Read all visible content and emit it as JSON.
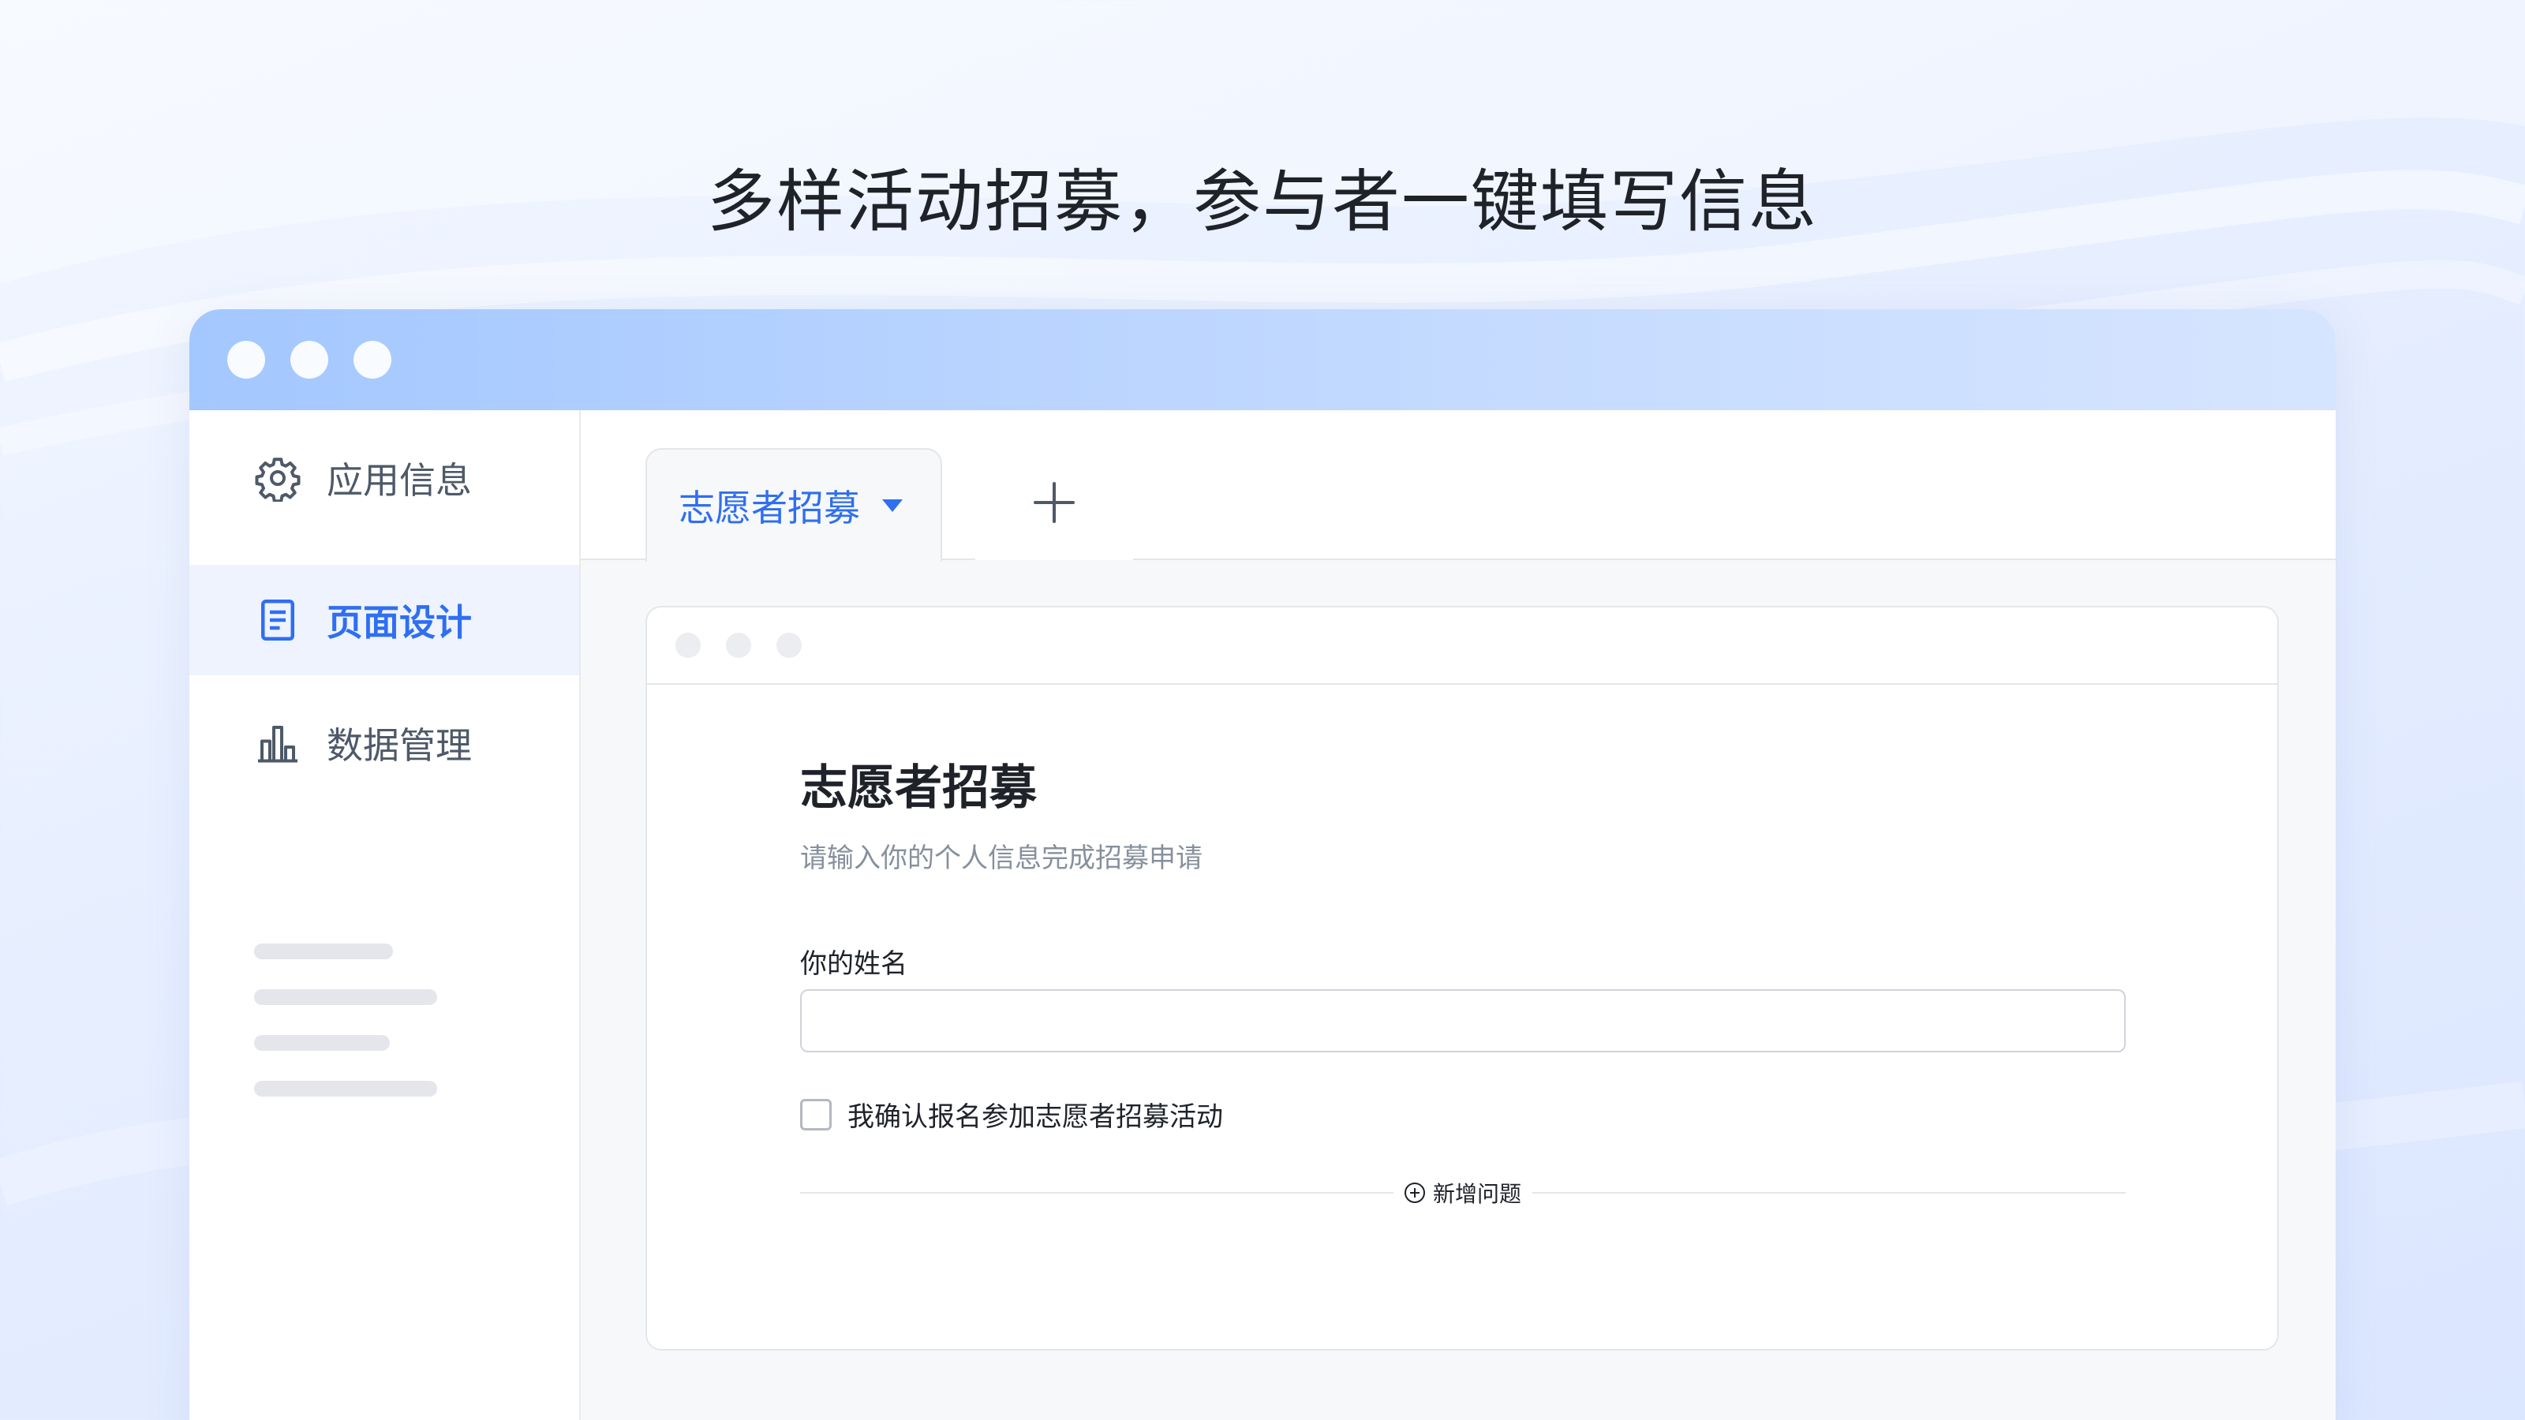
{
  "headline": "多样活动招募，参与者一键填写信息",
  "sidebar": {
    "items": [
      {
        "label": "应用信息",
        "icon": "gear-icon",
        "active": false
      },
      {
        "label": "页面设计",
        "icon": "document-icon",
        "active": true
      },
      {
        "label": "数据管理",
        "icon": "bar-chart-icon",
        "active": false
      }
    ]
  },
  "tabs": {
    "active_label": "志愿者招募",
    "add_icon": "plus-icon"
  },
  "form": {
    "title": "志愿者招募",
    "description": "请输入你的个人信息完成招募申请",
    "name_label": "你的姓名",
    "name_value": "",
    "confirm_label": "我确认报名参加志愿者招募活动",
    "add_question_label": "新增问题"
  },
  "colors": {
    "accent": "#2f6ff0",
    "active_bg": "#eef3fe",
    "titlebar_start": "#a3c7ff",
    "titlebar_end": "#d6e5ff"
  }
}
